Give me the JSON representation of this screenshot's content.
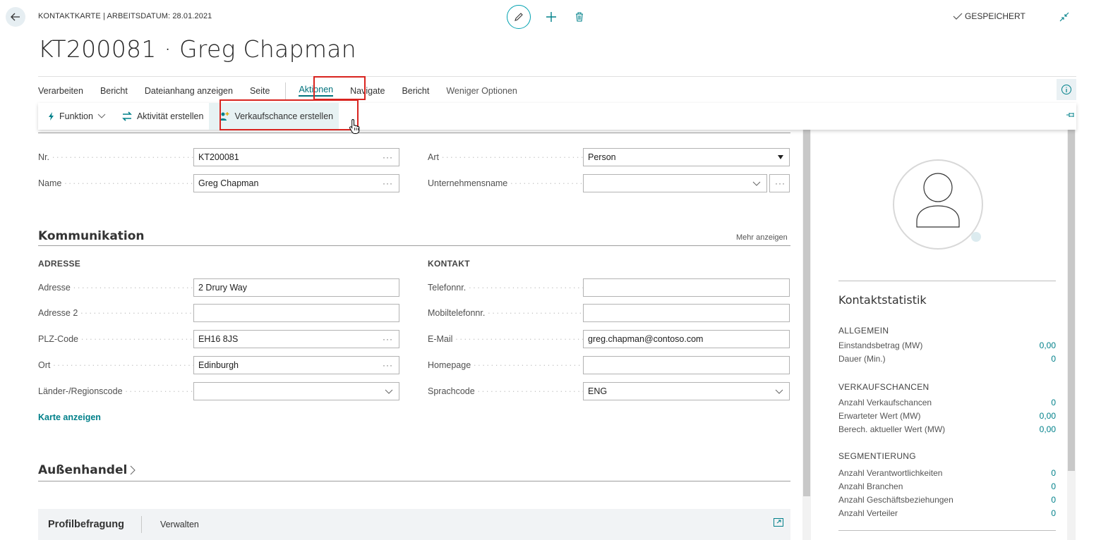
{
  "header": {
    "caption": "KONTAKTKARTE | ARBEITSDATUM: 28.01.2021",
    "title": "KT200081 · Greg Chapman",
    "saved": "GESPEICHERT"
  },
  "actionbar": {
    "items": [
      "Verarbeiten",
      "Bericht",
      "Dateianhang anzeigen",
      "Seite"
    ],
    "items2": [
      "Aktionen",
      "Navigate",
      "Bericht",
      "Weniger Optionen"
    ]
  },
  "subbar": {
    "funktion": "Funktion",
    "aktivitaet": "Aktivität erstellen",
    "verkaufschance": "Verkaufschance erstellen"
  },
  "general": {
    "nr_label": "Nr.",
    "nr_value": "KT200081",
    "name_label": "Name",
    "name_value": "Greg Chapman",
    "art_label": "Art",
    "art_value": "Person",
    "company_label": "Unternehmensname",
    "company_value": ""
  },
  "kommunikation": {
    "title": "Kommunikation",
    "more": "Mehr anzeigen",
    "adresse_hdr": "ADRESSE",
    "kontakt_hdr": "KONTAKT",
    "adresse_label": "Adresse",
    "adresse_value": "2 Drury Way",
    "adresse2_label": "Adresse 2",
    "adresse2_value": "",
    "plz_label": "PLZ-Code",
    "plz_value": "EH16 8JS",
    "ort_label": "Ort",
    "ort_value": "Edinburgh",
    "land_label": "Länder-/Regionscode",
    "land_value": "",
    "tel_label": "Telefonnr.",
    "tel_value": "",
    "mobil_label": "Mobiltelefonnr.",
    "mobil_value": "",
    "email_label": "E-Mail",
    "email_value": "greg.chapman@contoso.com",
    "homepage_label": "Homepage",
    "homepage_value": "",
    "sprach_label": "Sprachcode",
    "sprach_value": "ENG",
    "map_link": "Karte anzeigen"
  },
  "aussenhandel": {
    "title": "Außenhandel"
  },
  "profil": {
    "title": "Profilbefragung",
    "manage": "Verwalten"
  },
  "factbox": {
    "title": "Kontaktstatistik",
    "groups": [
      {
        "header": "ALLGEMEIN",
        "rows": [
          {
            "label": "Einstandsbetrag (MW)",
            "value": "0,00",
            "link": true
          },
          {
            "label": "Dauer (Min.)",
            "value": "0",
            "link": true
          }
        ]
      },
      {
        "header": "VERKAUFSCHANCEN",
        "rows": [
          {
            "label": "Anzahl Verkaufschancen",
            "value": "0",
            "link": true
          },
          {
            "label": "Erwarteter Wert (MW)",
            "value": "0,00",
            "link": true
          },
          {
            "label": "Berech. aktueller Wert (MW)",
            "value": "0,00",
            "link": true
          }
        ]
      },
      {
        "header": "SEGMENTIERUNG",
        "rows": [
          {
            "label": "Anzahl Verantwortlichkeiten",
            "value": "0",
            "link": true
          },
          {
            "label": "Anzahl Branchen",
            "value": "0",
            "link": true
          },
          {
            "label": "Anzahl Geschäftsbeziehungen",
            "value": "0",
            "link": true
          },
          {
            "label": "Anzahl Verteiler",
            "value": "0",
            "link": true
          }
        ]
      }
    ]
  },
  "colors": {
    "accent": "#00808a",
    "highlight_border": "#d9241f",
    "subbar_highlight": "#e7f2f3"
  }
}
